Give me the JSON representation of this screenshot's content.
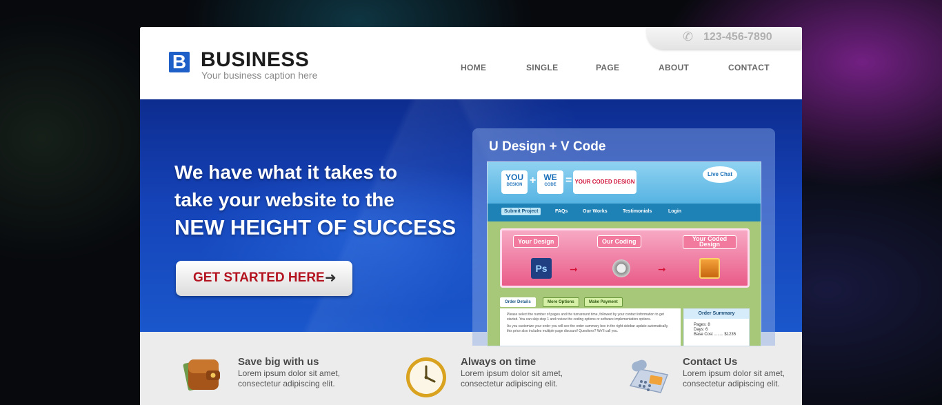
{
  "brand": {
    "mark": "B",
    "name": "BUSINESS",
    "caption": "Your business caption here"
  },
  "phone": {
    "number": "123-456-7890"
  },
  "nav": [
    {
      "label": "HOME"
    },
    {
      "label": "SINGLE"
    },
    {
      "label": "PAGE"
    },
    {
      "label": "ABOUT"
    },
    {
      "label": "CONTACT"
    }
  ],
  "hero": {
    "line1": "We have what it takes to",
    "line2": "take your website to the",
    "line3": "NEW HEIGHT OF SUCCESS",
    "cta_label": "GET STARTED HERE"
  },
  "preview": {
    "title": "U Design + V Code",
    "you_label": "YOU",
    "you_sub": "DESIGN",
    "we_label": "WE",
    "we_sub": "CODE",
    "coded_label": "YOUR CODED DESIGN",
    "live_chat": "Live Chat",
    "nav": [
      {
        "label": "Submit Project"
      },
      {
        "label": "FAQs"
      },
      {
        "label": "Our Works"
      },
      {
        "label": "Testimonials"
      },
      {
        "label": "Login"
      }
    ],
    "steps": [
      {
        "label": "Your Design"
      },
      {
        "label": "Our Coding"
      },
      {
        "label": "Your Coded Design"
      }
    ],
    "ps_label": "Ps",
    "tabs": [
      {
        "label": "Order Details"
      },
      {
        "label": "More Options"
      },
      {
        "label": "Make Payment"
      }
    ],
    "body_text_1": "Please select the number of pages and the turnaround time, followed by your contact information to get started. You can skip step 1 and review the coding options or software implementation options.",
    "body_text_2": "As you customize your order you will see the order summary box in the right sidebar update automatically, this price also includes multiple page discount! Questions? We'll call you.",
    "summary_title": "Order Summary",
    "summary_pages": "Pages: 8",
    "summary_days": "Days: 6",
    "summary_cost": "Base Cost ........ $1235"
  },
  "features": [
    {
      "title": "Save big with us",
      "text": "Lorem ipsum dolor sit amet, consectetur adipiscing elit.",
      "icon": "wallet-icon"
    },
    {
      "title": "Always on time",
      "text": "Lorem ipsum dolor sit amet, consectetur adipiscing elit.",
      "icon": "clock-icon"
    },
    {
      "title": "Contact Us",
      "text": "Lorem ipsum dolor sit amet, consectetur adipiscing elit.",
      "icon": "telephone-icon"
    }
  ],
  "colors": {
    "brand_blue": "#1f5fc8",
    "cta_red": "#b3121f",
    "hero_blue": "#1543b8"
  }
}
